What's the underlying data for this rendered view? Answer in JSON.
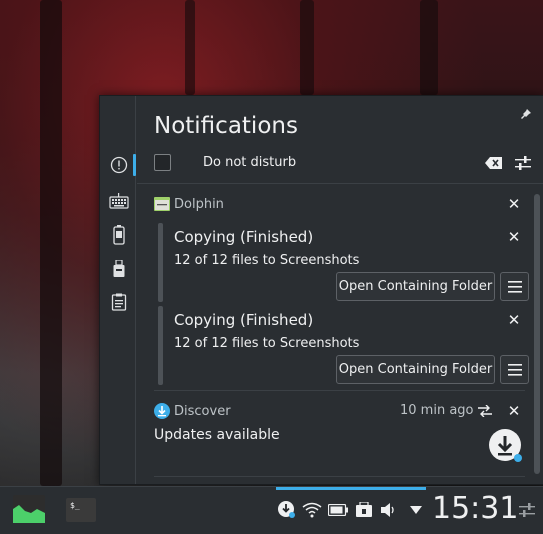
{
  "popup": {
    "title": "Notifications",
    "do_not_disturb_label": "Do not disturb"
  },
  "groups": [
    {
      "app": "Dolphin",
      "notifications": [
        {
          "title": "Copying (Finished)",
          "body": "12 of 12 files to Screenshots",
          "action": "Open Containing Folder"
        },
        {
          "title": "Copying (Finished)",
          "body": "12 of 12 files to Screenshots",
          "action": "Open Containing Folder"
        }
      ]
    },
    {
      "app": "Discover",
      "time": "10 min ago",
      "body": "Updates available"
    }
  ],
  "taskbar": {
    "clock": "15:31"
  },
  "colors": {
    "accent": "#3daee9",
    "panel_bg": "#2a2e32"
  },
  "icons": {
    "sidebar": [
      "notifications-icon",
      "keyboard-icon",
      "battery-icon",
      "usb-drive-icon",
      "clipboard-icon"
    ],
    "tray": [
      "discover-updates-icon",
      "network-wifi-icon",
      "battery-icon",
      "device-notifier-icon",
      "volume-icon",
      "expand-tray-icon"
    ]
  }
}
